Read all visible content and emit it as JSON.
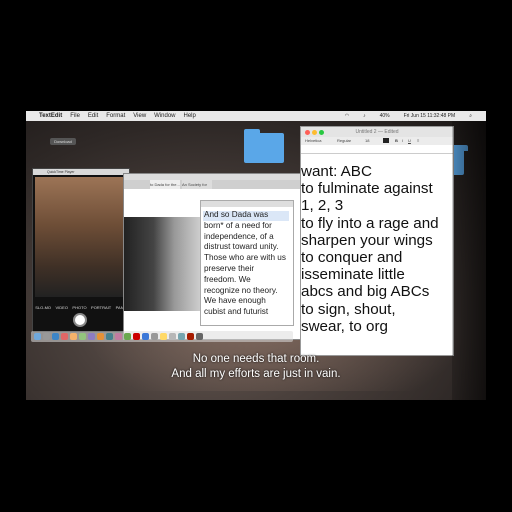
{
  "menubar": {
    "app": "TextEdit",
    "items": [
      "File",
      "Edit",
      "Format",
      "View",
      "Window",
      "Help"
    ],
    "clock": "Fri Jun 15  11:32:48 PM",
    "battery": "40%"
  },
  "desktop": {
    "badge": "Download"
  },
  "photobooth": {
    "title": "QuickTime Player",
    "modes": [
      "SLO-MO",
      "VIDEO",
      "PHOTO",
      "PORTRAIT",
      "PANO"
    ]
  },
  "browser": {
    "tab1": "to Dada for the...",
    "tab2": "An Society for the S..."
  },
  "dada_doc": {
    "text": "And so Dada was\nborn* of a need for\nindependence, of a\ndistrust toward unity.\nThose who are with us\npreserve their\nfreedom. We\nrecognize no theory.\nWe have enough\ncubist and futurist"
  },
  "textedit": {
    "title": "Untitled 2 — Edited",
    "font": "Helvetica",
    "style": "Regular",
    "size": "18",
    "body": "want: ABC\nto fulminate against\n1, 2, 3\nto fly into a rage and\nsharpen your wings\nto conquer and\nisseminate little\nabcs and big ABCs\nto sign, shout,\nswear, to org"
  },
  "subtitles": {
    "line1": "No one needs that room.",
    "line2": "And all my efforts are just in vain."
  },
  "colors": {
    "folder": "#5aa7e8",
    "close": "#ff5f57",
    "minimize": "#febc2e",
    "zoom": "#28c840"
  }
}
